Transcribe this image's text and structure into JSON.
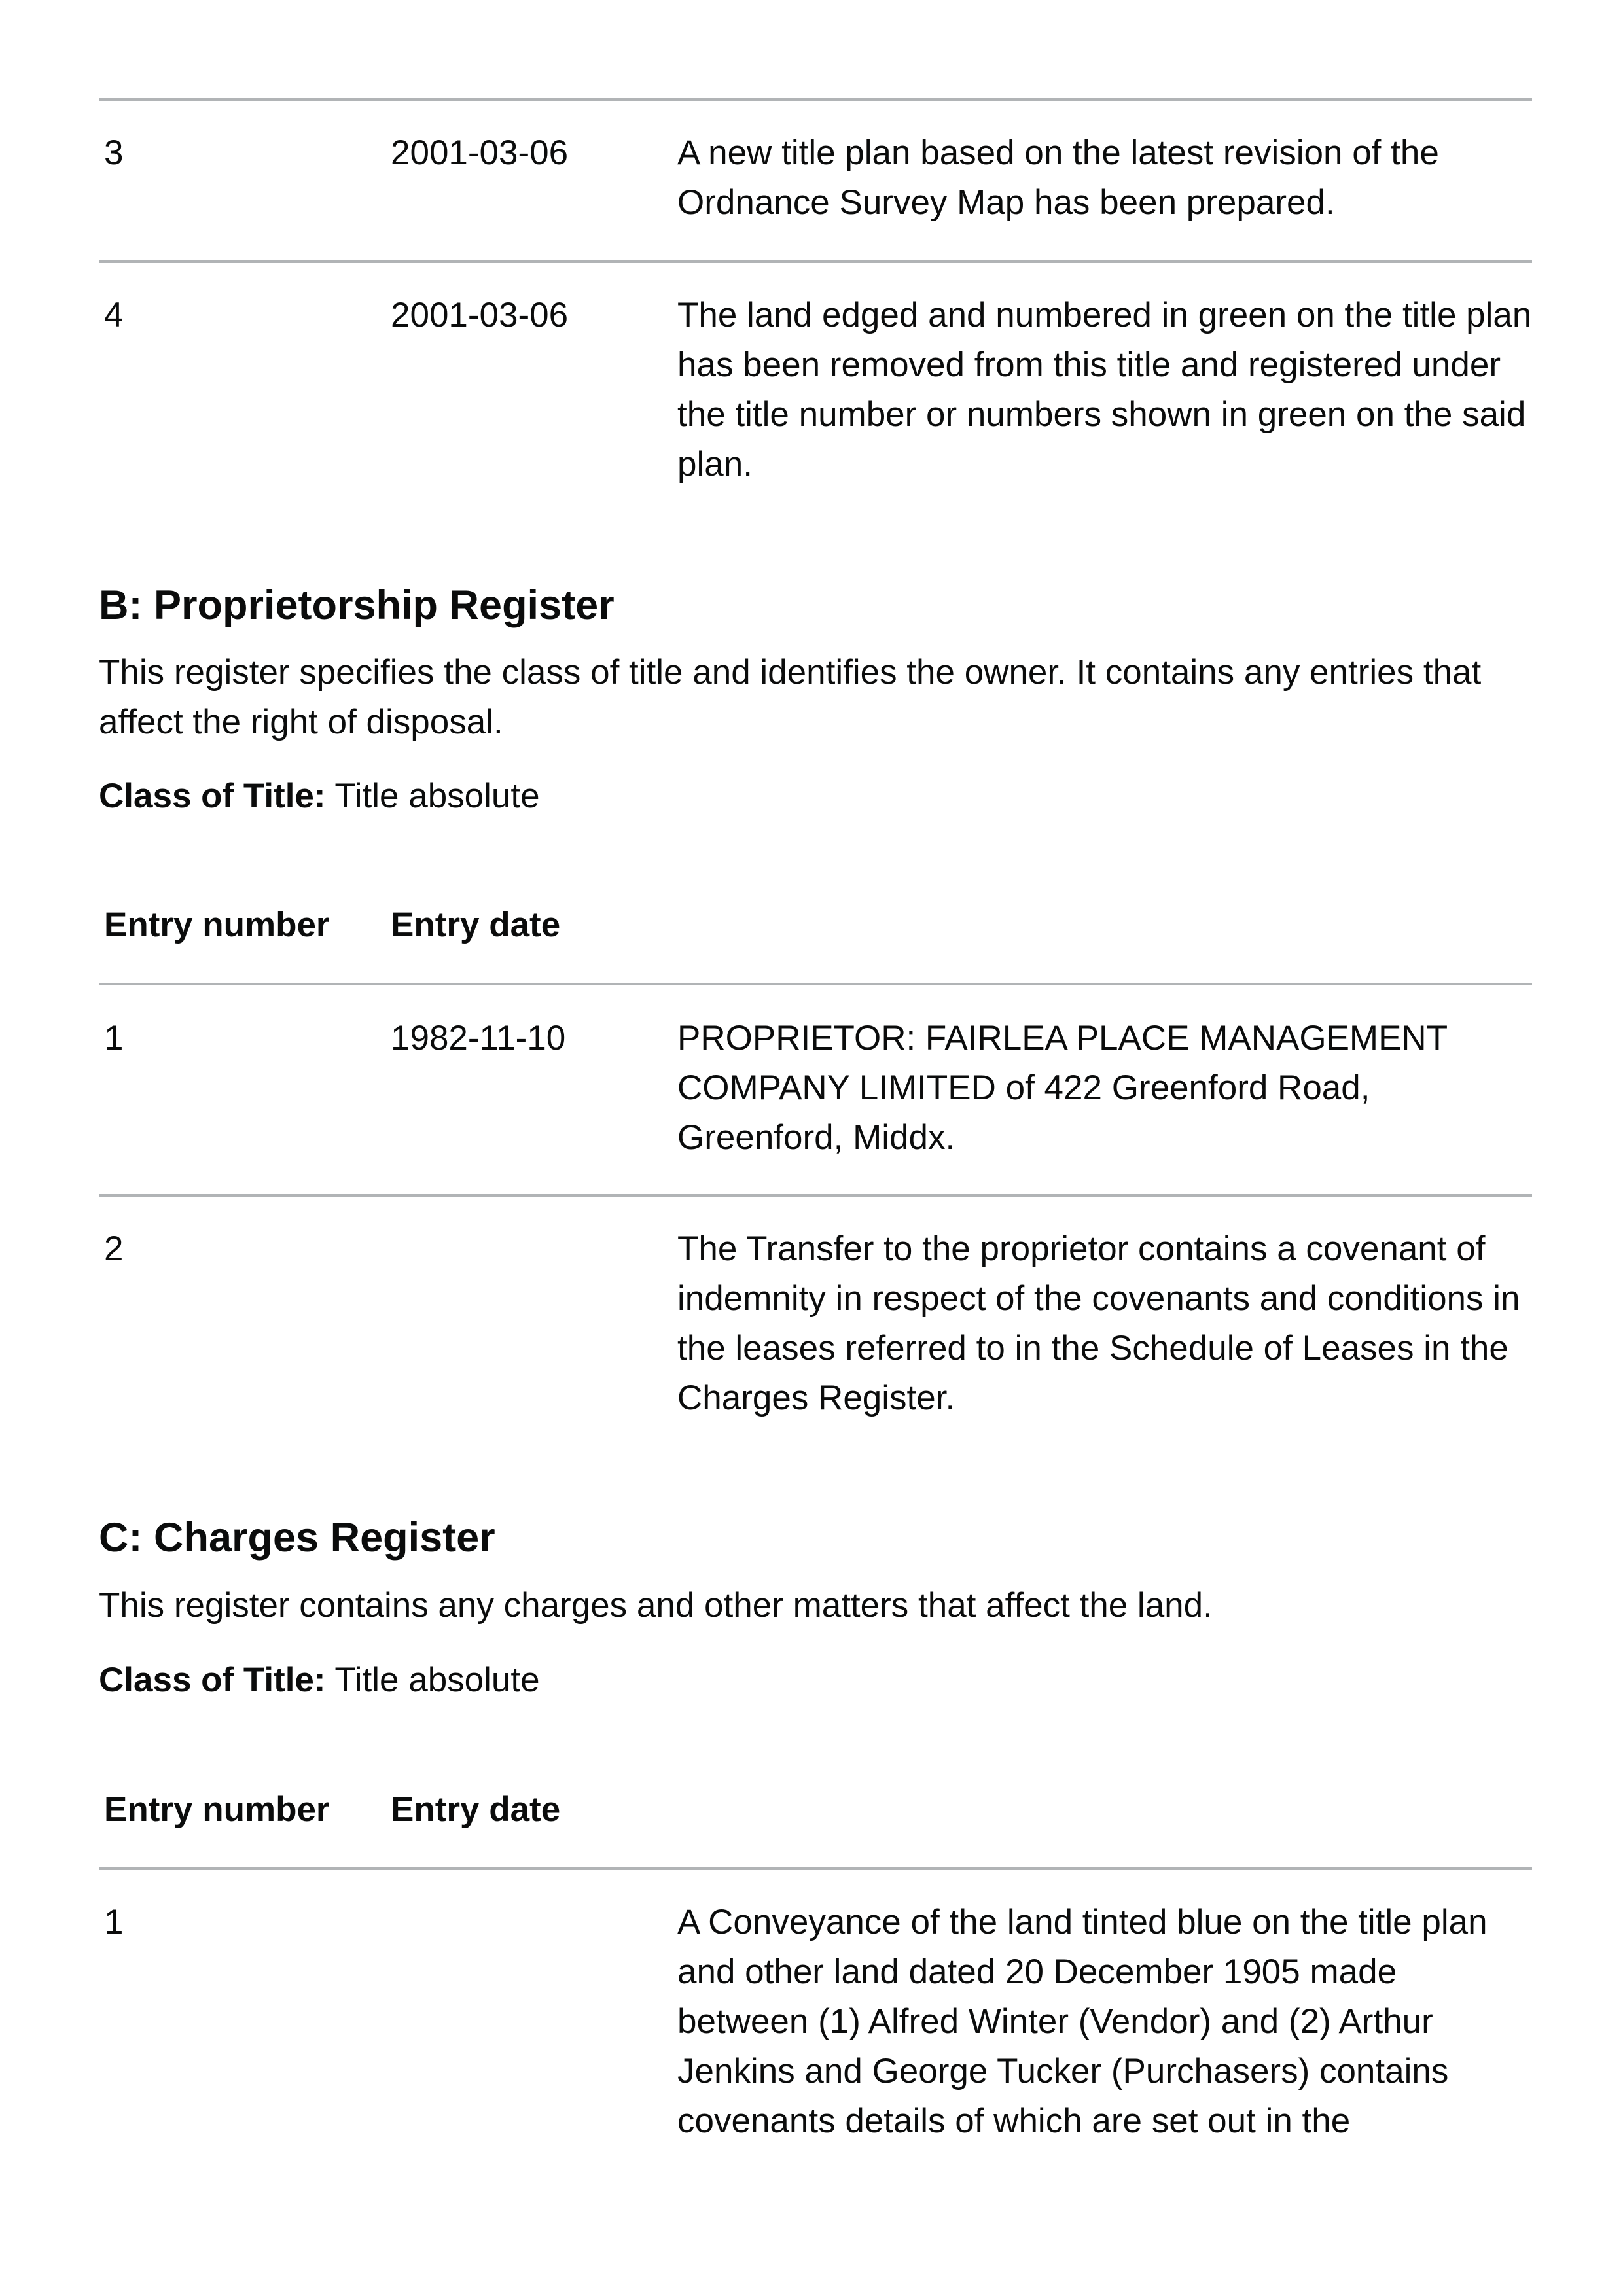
{
  "property_register_tail": [
    {
      "number": "3",
      "date": "2001-03-06",
      "text": "A new title plan based on the latest revision of the Ordnance Survey Map has been prepared."
    },
    {
      "number": "4",
      "date": "2001-03-06",
      "text": "The land edged and numbered in green on the title plan has been removed from this title and registered under the title number or numbers shown in green on the said plan."
    }
  ],
  "proprietorship": {
    "heading": "B: Proprietorship Register",
    "description": "This register specifies the class of title and identifies the owner. It contains any entries that affect the right of disposal.",
    "class_label": "Class of Title:",
    "class_value": "Title absolute",
    "columns": {
      "entry_number": "Entry number",
      "entry_date": "Entry date"
    },
    "entries": [
      {
        "number": "1",
        "date": "1982-11-10",
        "text": "PROPRIETOR: FAIRLEA PLACE MANAGEMENT COMPANY LIMITED of 422 Greenford Road, Greenford, Middx."
      },
      {
        "number": "2",
        "date": "",
        "text": "The Transfer to the proprietor contains a covenant of indemnity in respect of the covenants and conditions in the leases referred to in the Schedule of Leases in the Charges Register."
      }
    ]
  },
  "charges": {
    "heading": "C: Charges Register",
    "description": "This register contains any charges and other matters that affect the land.",
    "class_label": "Class of Title:",
    "class_value": "Title absolute",
    "columns": {
      "entry_number": "Entry number",
      "entry_date": "Entry date"
    },
    "entries": [
      {
        "number": "1",
        "date": "",
        "text": "A Conveyance of the land tinted blue on the title plan and other land dated 20 December 1905 made between (1) Alfred Winter (Vendor) and (2) Arthur Jenkins and George Tucker (Purchasers) contains covenants details of which are set out in the"
      }
    ]
  }
}
